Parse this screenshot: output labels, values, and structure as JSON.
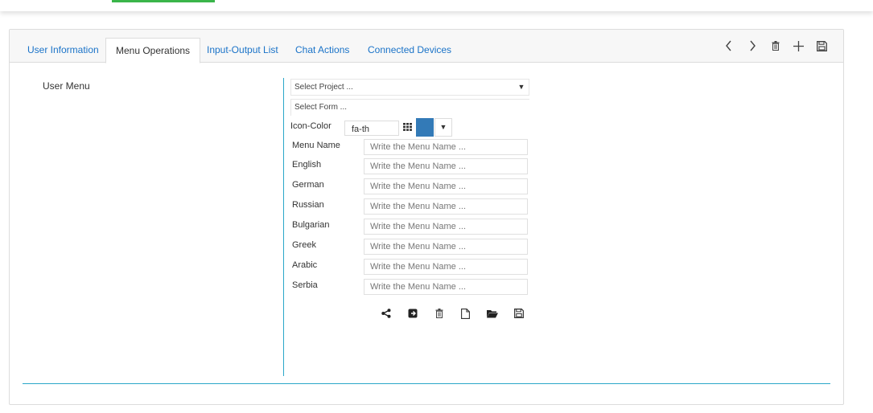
{
  "tabs": [
    {
      "label": "User Information"
    },
    {
      "label": "Menu Operations"
    },
    {
      "label": "Input-Output List"
    },
    {
      "label": "Chat Actions"
    },
    {
      "label": "Connected Devices"
    }
  ],
  "active_tab": "Menu Operations",
  "toolbar_icons": [
    "chevron-left-icon",
    "chevron-right-icon",
    "trash-icon",
    "plus-icon",
    "save-icon"
  ],
  "left_panel": {
    "label": "User Menu"
  },
  "form": {
    "project_select": "Select Project ...",
    "form_select": "Select Form ...",
    "icon_color_label": "Icon-Color",
    "icon_value": "fa-th",
    "icon_color": "#337ab7",
    "fields": [
      {
        "label": "Menu Name",
        "placeholder": "Write the Menu Name ..."
      },
      {
        "label": "English",
        "placeholder": "Write the Menu Name ..."
      },
      {
        "label": "German",
        "placeholder": "Write the Menu Name ..."
      },
      {
        "label": "Russian",
        "placeholder": "Write the Menu Name ..."
      },
      {
        "label": "Bulgarian",
        "placeholder": "Write the Menu Name ..."
      },
      {
        "label": "Greek",
        "placeholder": "Write the Menu Name ..."
      },
      {
        "label": "Arabic",
        "placeholder": "Write the Menu Name ..."
      },
      {
        "label": "Serbia",
        "placeholder": "Write the Menu Name ..."
      }
    ],
    "action_icons": [
      "share-icon",
      "export-icon",
      "trash-icon",
      "new-file-icon",
      "folder-open-icon",
      "save-icon"
    ]
  },
  "colors": {
    "accent": "#1a73c8",
    "divider": "#2aa7c9",
    "top_active": "#3ab54a"
  }
}
